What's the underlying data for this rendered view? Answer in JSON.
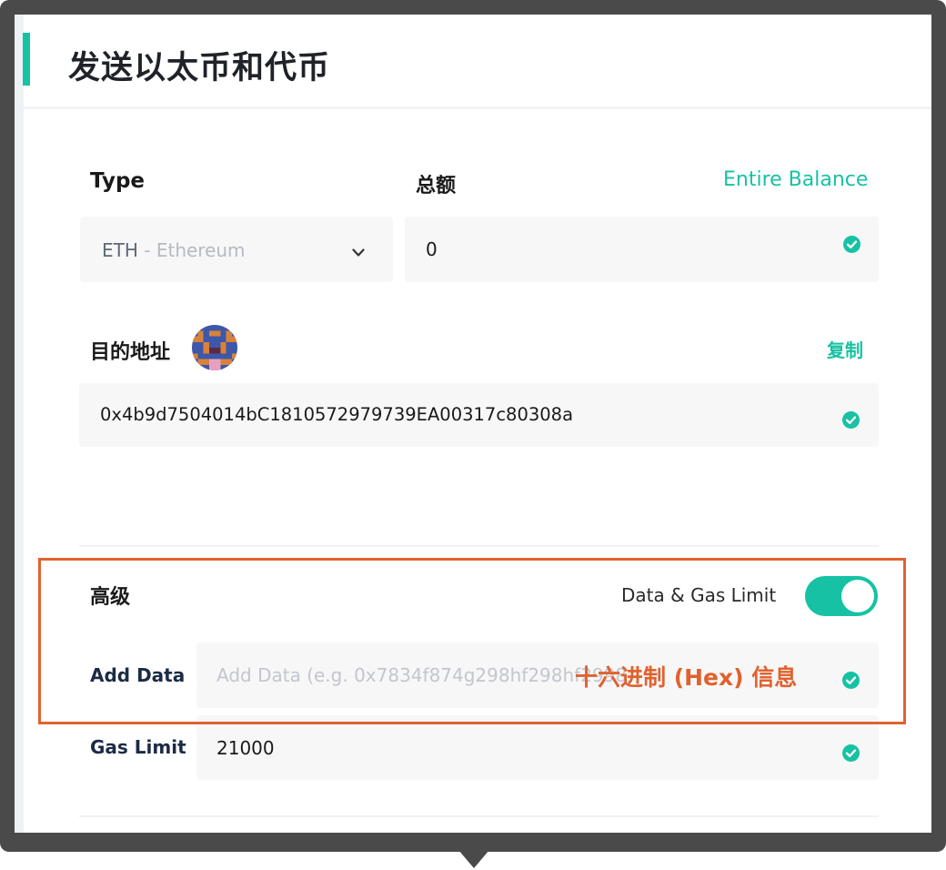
{
  "page": {
    "title": "发送以太币和代币"
  },
  "form": {
    "type_label": "Type",
    "amount_label": "总额",
    "entire_balance_link": "Entire Balance",
    "type_select": {
      "symbol": "ETH",
      "name_suffix": " - Ethereum"
    },
    "amount_value": "0",
    "destination_label": "目的地址",
    "copy_link": "复制",
    "destination_value": "0x4b9d7504014bC1810572979739EA00317c80308a"
  },
  "advanced": {
    "label": "高级",
    "toggle_label": "Data & Gas Limit",
    "toggle_on": true,
    "data_label": "Add Data",
    "data_placeholder": "Add Data (e.g. 0x7834f874g298hf298hf2998",
    "gas_label": "Gas Limit",
    "gas_value": "21000"
  },
  "annotation": {
    "text": "十六进制 (Hex) 信息",
    "color": "#e0622e"
  },
  "colors": {
    "accent": "#16c2a3",
    "frame": "#4a4a4a",
    "field_bg": "#f7f7f8",
    "annotation": "#e0622e"
  },
  "icons": {
    "select": "chevron-down-icon",
    "valid": "check-circle-icon",
    "avatar": "identicon-avatar"
  }
}
